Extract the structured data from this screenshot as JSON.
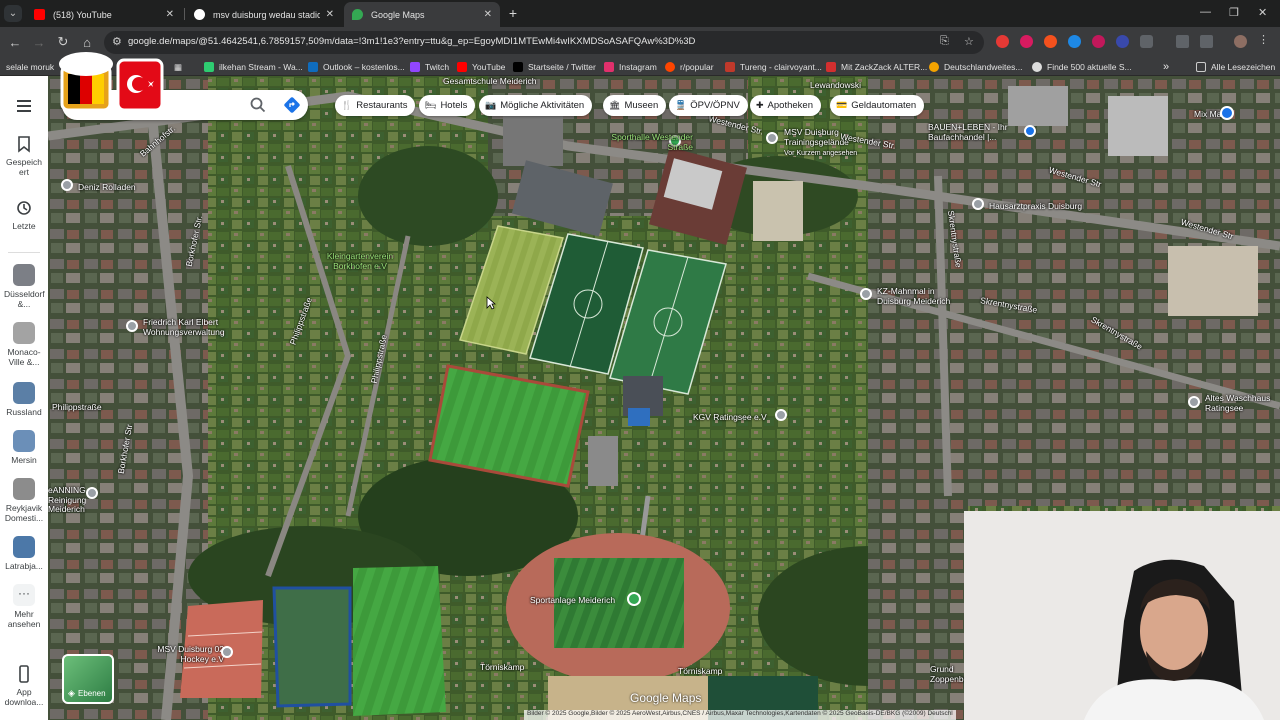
{
  "tabs": [
    {
      "title": "(518) YouTube",
      "fav_color": "#ff0000",
      "active": false
    },
    {
      "title": "msv duisburg wedau stadion - Go",
      "fav_color": "#ffffff",
      "active": false
    },
    {
      "title": "Google Maps",
      "fav_color": "#34a853",
      "active": true
    }
  ],
  "toolbar": {
    "url": "google.de/maps/@51.4642541,6.7859157,509m/data=!3m1!1e3?entry=ttu&g_ep=EgoyMDI1MTEwMi4wIKXMDSoASAFQAw%3D%3D"
  },
  "bookmarks": {
    "items": [
      {
        "label": "selale moruk",
        "color": "#3a3b3d"
      },
      {
        "label": "",
        "color": "#888888"
      },
      {
        "label": "ilkehan Stream - Wa...",
        "color": "#2ecc71"
      },
      {
        "label": "Outlook – kostenlos...",
        "color": "#0f6cbd"
      },
      {
        "label": "Twitch",
        "color": "#9146ff"
      },
      {
        "label": "YouTube",
        "color": "#ff0000"
      },
      {
        "label": "Startseite / Twitter",
        "color": "#000000"
      },
      {
        "label": "Instagram",
        "color": "#e1306c"
      },
      {
        "label": "r/popular",
        "color": "#ff4500"
      },
      {
        "label": "Tureng - clairvoyant...",
        "color": "#c0392b"
      },
      {
        "label": "Mit ZackZack ALTER...",
        "color": "#d32f2f"
      },
      {
        "label": "Deutschlandweites...",
        "color": "#f4a300"
      },
      {
        "label": "Finde 500 aktuelle S...",
        "color": "#dddddd"
      }
    ],
    "more": "»",
    "all_bookmarks": "Alle Lesezeichen"
  },
  "rail": {
    "saved": "Gespeichert",
    "recent": "Letzte",
    "recent_places": [
      {
        "label": "Düsseldorf &...",
        "thumb_color": "#7c7f86"
      },
      {
        "label": "Monaco-Ville &...",
        "thumb_color": "#a3a3a3"
      },
      {
        "label": "Russland",
        "thumb_color": "#5b7fa6"
      },
      {
        "label": "Mersin",
        "thumb_color": "#6b8fb8"
      },
      {
        "label": "Reykjavik Domesti...",
        "thumb_color": "#8c8c8c"
      },
      {
        "label": "Latrabja...",
        "thumb_color": "#4c78a8"
      }
    ],
    "more": "Mehr ansehen",
    "app": "App downloa..."
  },
  "search": {
    "placeholder": "n"
  },
  "chips": [
    "Restaurants",
    "Hotels",
    "Mögliche Aktivitäten",
    "Museen",
    "ÖPV/ÖPNV",
    "Apotheken",
    "Geldautomaten"
  ],
  "map_labels": [
    {
      "text": "Gesamtschule Meiderich"
    },
    {
      "text": "Sporthalle Westender Straße"
    },
    {
      "text": "MSV Duisburg Trainingsgelände"
    },
    {
      "text": "Vor Kurzem angesehen"
    },
    {
      "text": "BAUEN+LEBEN - Ihr Baufachhandel |..."
    },
    {
      "text": "Mix Markt"
    },
    {
      "text": "Deniz Rolladen"
    },
    {
      "text": "Hausarztpraxis Duisburg"
    },
    {
      "text": "Kleingartenverein Borkhofen e.V"
    },
    {
      "text": "KZ-Mahnmal in Duisburg Meiderich"
    },
    {
      "text": "Friedrich Karl Elbert Wohnungsverwaltung"
    },
    {
      "text": "Altes Waschhaus Ratingsee"
    },
    {
      "text": "KGV Ratingsee e.V"
    },
    {
      "text": "eANNING Reinigung"
    },
    {
      "text": "Sportanlage Meiderich"
    },
    {
      "text": "MSV Duisburg 02 Hockey e.V"
    },
    {
      "text": "Grund Zoppenbr"
    },
    {
      "text": "Lewandowski"
    }
  ],
  "streets": [
    {
      "text": "Westender Str."
    },
    {
      "text": "Westender Str."
    },
    {
      "text": "Westender Str"
    },
    {
      "text": "Bahnhofstr."
    },
    {
      "text": "Borkhofer Str."
    },
    {
      "text": "Borkhofer Str"
    },
    {
      "text": "Philippstraße"
    },
    {
      "text": "Philippstraße"
    },
    {
      "text": "Philippstraße"
    },
    {
      "text": "Skrentnystraße"
    },
    {
      "text": "Skrentnystraße"
    },
    {
      "text": "Skrentnystraße"
    },
    {
      "text": "Westender Str"
    },
    {
      "text": "Törniskamp"
    },
    {
      "text": "Törniskamp"
    },
    {
      "text": "Meiderich"
    }
  ],
  "layers_label": "Ebenen",
  "google_maps": "Google Maps",
  "attribution": "Bilder © 2025 Google,Bilder © 2025 AeroWest,Airbus,CNES / Airbus,Maxar Technologies,Kartendaten © 2025 GeoBasis-DE/BKG (©2009)   Deutschl"
}
